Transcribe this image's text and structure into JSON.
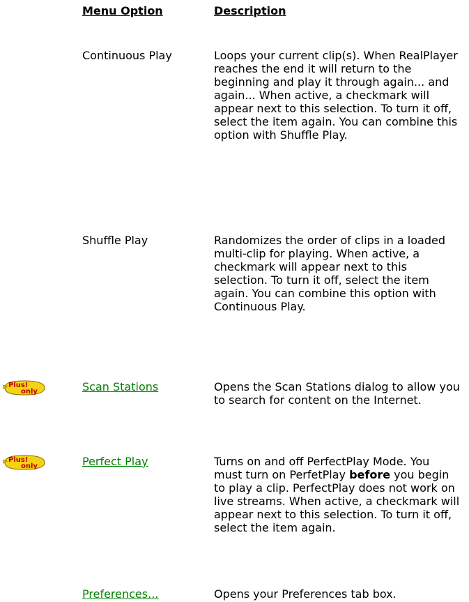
{
  "header": {
    "option_label": "Menu Option",
    "description_label": "Description"
  },
  "badge": {
    "text_top": "Plus!",
    "text_bottom": "only"
  },
  "rows": [
    {
      "option": "Continuous Play",
      "description": "Loops your current clip(s). When RealPlayer reaches the end it will return to the beginning and play it through again... and again... When active, a checkmark will appear next to this selection. To turn it off, select the item again. You can combine this option with Shuffle Play."
    },
    {
      "option": "Shuffle Play",
      "description": "Randomizes the order of clips in a loaded multi-clip for playing. When active, a checkmark will appear next to this selection. To turn it off, select the item again. You can combine this option with Continuous Play."
    },
    {
      "option": "Scan Stations",
      "description": "Opens the Scan Stations dialog to allow you to search for content on the Internet."
    },
    {
      "option": "Perfect Play ",
      "description_part1": "Turns on and off PerfectPlay Mode. You must turn on PerfetPlay ",
      "description_bold": "before",
      "description_part2": " you begin to play a clip. PerfectPlay does not work on live streams. When active, a checkmark will appear next to this selection. To turn it off, select the item again."
    },
    {
      "option": "Preferences...",
      "description": "Opens your Preferences tab box."
    }
  ],
  "colors": {
    "link": "#008000",
    "badge_fill": "#f5d313",
    "badge_text": "#c00000"
  }
}
